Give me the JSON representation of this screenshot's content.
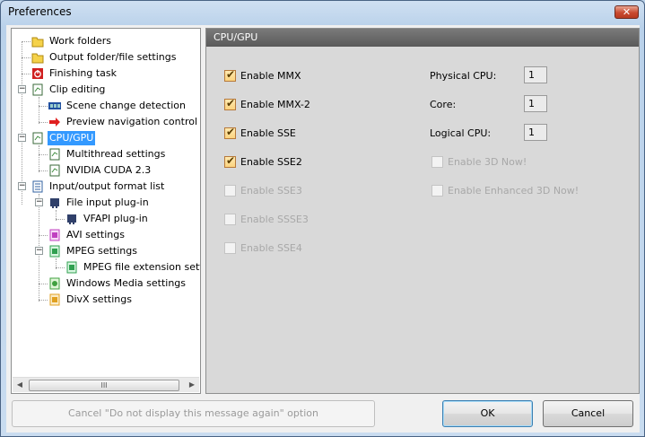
{
  "window": {
    "title": "Preferences",
    "close_glyph": "✕"
  },
  "tree": {
    "items": [
      {
        "label": "Work folders",
        "icon": "folder-icon",
        "color": "#f5d24a"
      },
      {
        "label": "Output folder/file settings",
        "icon": "folder-icon",
        "color": "#f5d24a"
      },
      {
        "label": "Finishing task",
        "icon": "power-icon",
        "color": "#d02020"
      },
      {
        "label": "Clip editing",
        "icon": "document-icon",
        "color": "#3a8a3a"
      },
      {
        "label": "Scene change detection",
        "icon": "film-icon",
        "color": "#2050a0"
      },
      {
        "label": "Preview navigation control",
        "icon": "red-arrow-icon",
        "color": "#e02020"
      },
      {
        "label": "CPU/GPU",
        "icon": "document-icon",
        "color": "#3a8a3a"
      },
      {
        "label": "Multithread settings",
        "icon": "document-icon",
        "color": "#3a8a3a"
      },
      {
        "label": "NVIDIA CUDA 2.3",
        "icon": "document-icon",
        "color": "#3a8a3a"
      },
      {
        "label": "Input/output format list",
        "icon": "list-icon",
        "color": "#3060a0"
      },
      {
        "label": "File input plug-in",
        "icon": "plugin-icon",
        "color": "#30406a"
      },
      {
        "label": "VFAPI plug-in",
        "icon": "plugin-icon",
        "color": "#30406a"
      },
      {
        "label": "AVI settings",
        "icon": "avi-file-icon",
        "color": "#c040c0"
      },
      {
        "label": "MPEG settings",
        "icon": "mpeg-file-icon",
        "color": "#30a050"
      },
      {
        "label": "MPEG file extension settings",
        "icon": "mpeg-file-icon",
        "color": "#30a050"
      },
      {
        "label": "Windows Media settings",
        "icon": "wm-file-icon",
        "color": "#40a040"
      },
      {
        "label": "DivX settings",
        "icon": "divx-file-icon",
        "color": "#e0a020"
      }
    ],
    "scroll_thumb_glyph": "III",
    "scroll_left_glyph": "◀",
    "scroll_right_glyph": "▶"
  },
  "panel": {
    "header": "CPU/GPU",
    "checkboxes": [
      {
        "label": "Enable MMX",
        "checked": true,
        "enabled": true
      },
      {
        "label": "Enable MMX-2",
        "checked": true,
        "enabled": true
      },
      {
        "label": "Enable SSE",
        "checked": true,
        "enabled": true
      },
      {
        "label": "Enable SSE2",
        "checked": true,
        "enabled": true
      },
      {
        "label": "Enable SSE3",
        "checked": false,
        "enabled": false
      },
      {
        "label": "Enable SSSE3",
        "checked": false,
        "enabled": false
      },
      {
        "label": "Enable SSE4",
        "checked": false,
        "enabled": false
      },
      {
        "label": "Enable 3D Now!",
        "checked": false,
        "enabled": false
      },
      {
        "label": "Enable Enhanced 3D Now!",
        "checked": false,
        "enabled": false
      }
    ],
    "info": {
      "physical_cpu_label": "Physical CPU:",
      "physical_cpu_value": "1",
      "core_label": "Core:",
      "core_value": "1",
      "logical_cpu_label": "Logical CPU:",
      "logical_cpu_value": "1"
    }
  },
  "buttons": {
    "cancel_message": "Cancel \"Do not display this message again\" option",
    "ok": "OK",
    "cancel": "Cancel"
  }
}
